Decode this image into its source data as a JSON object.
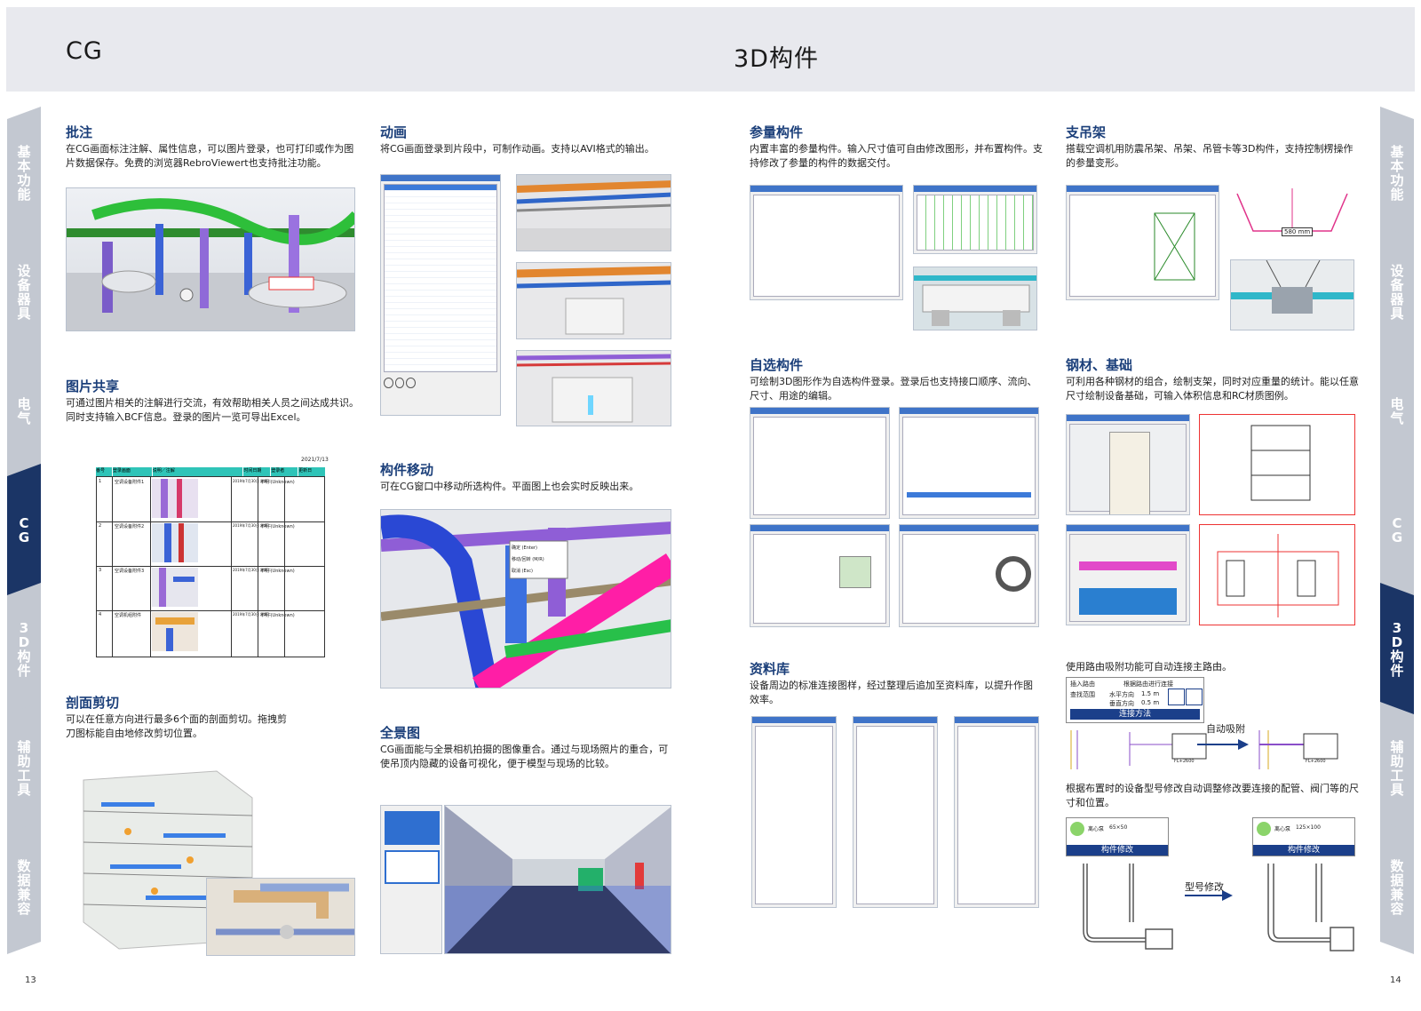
{
  "header": {
    "left_title": "CG",
    "right_title": "3D构件"
  },
  "left_tabs": [
    {
      "label": "基本功能",
      "active": false
    },
    {
      "label": "设备器具",
      "active": false
    },
    {
      "label": "电气",
      "active": false
    },
    {
      "label": "CG",
      "active": true
    },
    {
      "label": "3D构件",
      "active": false
    },
    {
      "label": "辅助工具",
      "active": false
    },
    {
      "label": "数据兼容",
      "active": false
    }
  ],
  "right_tabs": [
    {
      "label": "基本功能",
      "active": false
    },
    {
      "label": "设备器具",
      "active": false
    },
    {
      "label": "电气",
      "active": false
    },
    {
      "label": "CG",
      "active": false
    },
    {
      "label": "3D构件",
      "active": true
    },
    {
      "label": "辅助工具",
      "active": false
    },
    {
      "label": "数据兼容",
      "active": false
    }
  ],
  "sections": {
    "annotation": {
      "title": "批注",
      "desc": "在CG画面标注注解、属性信息，可以图片登录，也可打印或作为图片数据保存。免费的浏览器RebroViewert也支持批注功能。"
    },
    "image_share": {
      "title": "图片共享",
      "desc": "可通过图片相关的注解进行交流，有效帮助相关人员之间达成共识。同时支持输入BCF信息。登录的图片一览可导出Excel。"
    },
    "section_cut": {
      "title": "剖面剪切",
      "desc": "可以在任意方向进行最多6个面的剖面剪切。拖拽剪刀图标能自由地修改剪切位置。"
    },
    "animation": {
      "title": "动画",
      "desc": "将CG画面登录到片段中，可制作动画。支持以AVI格式的输出。"
    },
    "part_move": {
      "title": "构件移动",
      "desc": "可在CG窗口中移动所选构件。平面图上也会实时反映出来。"
    },
    "panorama": {
      "title": "全景图",
      "desc": "CG画面能与全景相机拍摄的图像重合。通过与现场照片的重合，可使吊顶内隐藏的设备可视化，便于模型与现场的比较。"
    },
    "param_parts": {
      "title": "参量构件",
      "desc": "内置丰富的参量构件。输入尺寸值可自由修改图形，并布置构件。支持修改了参量的构件的数据交付。"
    },
    "hanger": {
      "title": "支吊架",
      "desc": "搭载空调机用防震吊架、吊架、吊管卡等3D构件，支持控制楞操作的参量变形。"
    },
    "custom_parts": {
      "title": "自选构件",
      "desc": "可绘制3D图形作为自选构件登录。登录后也支持接口顺序、流向、尺寸、用途的编辑。"
    },
    "steel": {
      "title": "钢材、基础",
      "desc": "可利用各种钢材的组合，绘制支架，同时对应重量的统计。能以任意尺寸绘制设备基础，可输入体积信息和RC材质图例。"
    },
    "library": {
      "title": "资料库",
      "desc": "设备周边的标准连接图样，经过整理后追加至资料库，以提升作图效率。"
    },
    "routing": {
      "desc1": "使用路由吸附功能可自动连接主路由。",
      "auto_label": "自动吸附",
      "desc2": "根据布置时的设备型号修改自动调整修改要连接的配管、阀门等的尺寸和位置。",
      "model_label": "型号修改"
    }
  },
  "share_table": {
    "date": "2021/7/13",
    "headers": [
      "番号",
      "登录画面",
      "说明／注解",
      "时间日期",
      "登录者",
      "更新日"
    ],
    "rows": [
      {
        "no": "1",
        "name": "空调设备附件1",
        "date": "2019年7月30日 星期二",
        "user": "不明 (Unknown)"
      },
      {
        "no": "2",
        "name": "空调设备附件2",
        "date": "2019年7月30日 星期二",
        "user": "不明 (Unknown)"
      },
      {
        "no": "3",
        "name": "空调设备附件3",
        "date": "2019年7月30日 星期二",
        "user": "不明 (Unknown)"
      },
      {
        "no": "4",
        "name": "空调机组附件",
        "date": "2019年7月30日 星期二",
        "user": "不明 (Unknown)"
      }
    ]
  },
  "routing_dialog": {
    "check1": "插入路由",
    "check2": "根据路由进行连接",
    "range_label": "查找范围",
    "horiz_label": "水平方向",
    "horiz_value": "1.5 m",
    "vert_label": "垂直方向",
    "vert_value": "0.5 m",
    "button": "连接方法",
    "fl_tag1": "FL+2600",
    "fl_tag2": "FL+2600"
  },
  "pump_left": {
    "name": "离心泵",
    "size": "65×50",
    "button": "构件修改"
  },
  "pump_right": {
    "name": "离心泵",
    "size": "125×100",
    "button": "构件修改"
  },
  "hanger_tag": "580 mm",
  "context_menu": [
    "确定 (Enter)",
    "移动/回转 (M/R)",
    "取消 (Esc)"
  ],
  "page_numbers": {
    "left": "13",
    "right": "14"
  },
  "colors": {
    "header_band": "#e8e9ee",
    "active_tab": "#1b3566",
    "inactive_tab": "#c3c8d1",
    "section_title": "#1b3f7a"
  }
}
